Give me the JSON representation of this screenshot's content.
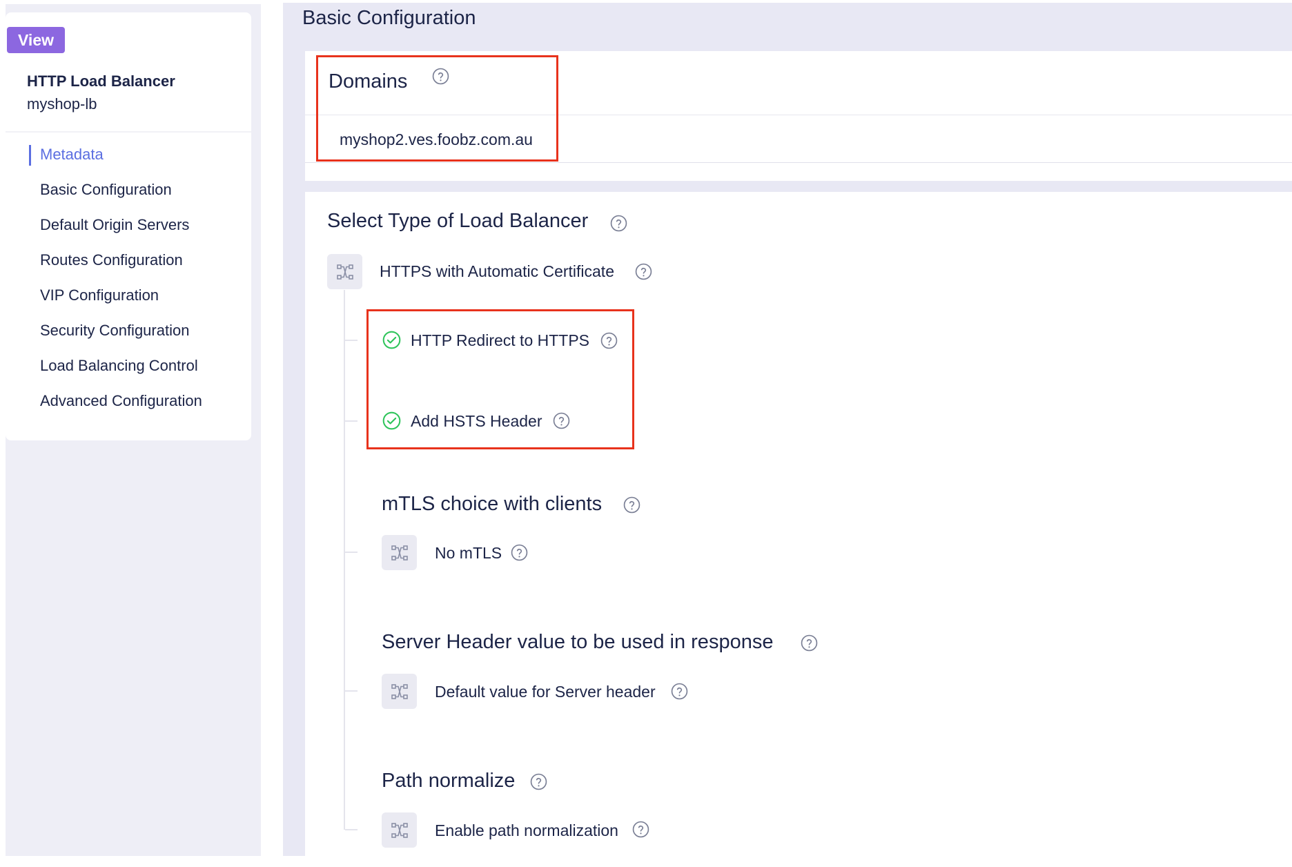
{
  "sidebar": {
    "badge": "View",
    "object_type": "HTTP Load Balancer",
    "object_name": "myshop-lb",
    "nav_items": [
      {
        "label": "Metadata",
        "active": true
      },
      {
        "label": "Basic Configuration",
        "active": false
      },
      {
        "label": "Default Origin Servers",
        "active": false
      },
      {
        "label": "Routes Configuration",
        "active": false
      },
      {
        "label": "VIP Configuration",
        "active": false
      },
      {
        "label": "Security Configuration",
        "active": false
      },
      {
        "label": "Load Balancing Control",
        "active": false
      },
      {
        "label": "Advanced Configuration",
        "active": false
      }
    ]
  },
  "main": {
    "section_title": "Basic Configuration",
    "domains": {
      "label": "Domains",
      "value": "myshop2.ves.foobz.com.au"
    },
    "lb_type": {
      "label": "Select Type of Load Balancer",
      "choice": "HTTPS with Automatic Certificate",
      "options": [
        {
          "label": "HTTP Redirect to HTTPS",
          "enabled": true
        },
        {
          "label": "Add HSTS Header",
          "enabled": true
        }
      ]
    },
    "mtls": {
      "label": "mTLS choice with clients",
      "choice": "No mTLS"
    },
    "server_header": {
      "label": "Server Header value to be used in response",
      "choice": "Default value for Server header"
    },
    "path_normalize": {
      "label": "Path normalize",
      "choice": "Enable path normalization"
    }
  },
  "colors": {
    "accent": "#5b6ee1",
    "badge": "#8c67e0",
    "highlight": "#e8321c",
    "check": "#2ec45a",
    "text": "#1c2447"
  },
  "icons": {
    "help": "question-circle-icon",
    "check": "check-circle-icon",
    "choice": "branch-icon"
  }
}
